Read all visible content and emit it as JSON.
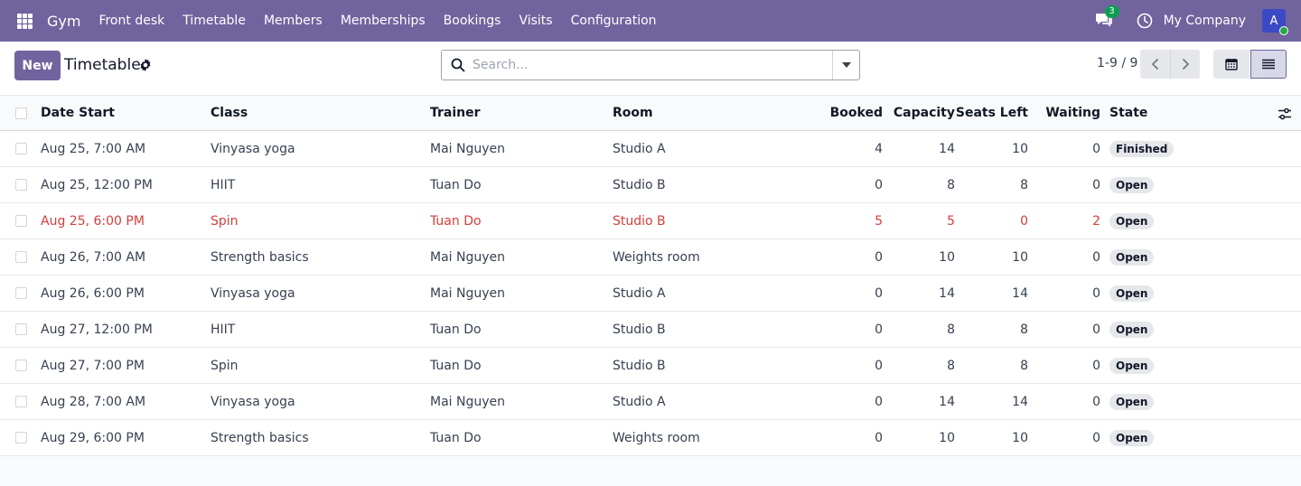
{
  "navbar": {
    "app_name": "Gym",
    "menu": [
      "Front desk",
      "Timetable",
      "Members",
      "Memberships",
      "Bookings",
      "Visits",
      "Configuration"
    ],
    "chat_count": "3",
    "company": "My Company",
    "avatar_letter": "A",
    "color": "#71639e"
  },
  "control": {
    "new_label": "New",
    "title": "Timetable",
    "search_placeholder": "Search...",
    "pager": "1-9 / 9"
  },
  "table": {
    "columns": [
      "Date Start",
      "Class",
      "Trainer",
      "Room",
      "Booked",
      "Capacity",
      "Seats Left",
      "Waiting",
      "State"
    ],
    "rows": [
      {
        "date": "Aug 25, 7:00 AM",
        "class": "Vinyasa yoga",
        "trainer": "Mai Nguyen",
        "room": "Studio A",
        "booked": "4",
        "capacity": "14",
        "seats": "10",
        "waiting": "0",
        "state": "Finished"
      },
      {
        "date": "Aug 25, 12:00 PM",
        "class": "HIIT",
        "trainer": "Tuan Do",
        "room": "Studio B",
        "booked": "0",
        "capacity": "8",
        "seats": "8",
        "waiting": "0",
        "state": "Open"
      },
      {
        "date": "Aug 25, 6:00 PM",
        "class": "Spin",
        "trainer": "Tuan Do",
        "room": "Studio B",
        "booked": "5",
        "capacity": "5",
        "seats": "0",
        "waiting": "2",
        "state": "Open"
      },
      {
        "date": "Aug 26, 7:00 AM",
        "class": "Strength basics",
        "trainer": "Mai Nguyen",
        "room": "Weights room",
        "booked": "0",
        "capacity": "10",
        "seats": "10",
        "waiting": "0",
        "state": "Open"
      },
      {
        "date": "Aug 26, 6:00 PM",
        "class": "Vinyasa yoga",
        "trainer": "Mai Nguyen",
        "room": "Studio A",
        "booked": "0",
        "capacity": "14",
        "seats": "14",
        "waiting": "0",
        "state": "Open"
      },
      {
        "date": "Aug 27, 12:00 PM",
        "class": "HIIT",
        "trainer": "Tuan Do",
        "room": "Studio B",
        "booked": "0",
        "capacity": "8",
        "seats": "8",
        "waiting": "0",
        "state": "Open"
      },
      {
        "date": "Aug 27, 7:00 PM",
        "class": "Spin",
        "trainer": "Tuan Do",
        "room": "Studio B",
        "booked": "0",
        "capacity": "8",
        "seats": "8",
        "waiting": "0",
        "state": "Open"
      },
      {
        "date": "Aug 28, 7:00 AM",
        "class": "Vinyasa yoga",
        "trainer": "Mai Nguyen",
        "room": "Studio A",
        "booked": "0",
        "capacity": "14",
        "seats": "14",
        "waiting": "0",
        "state": "Open"
      },
      {
        "date": "Aug 29, 6:00 PM",
        "class": "Strength basics",
        "trainer": "Tuan Do",
        "room": "Weights room",
        "booked": "0",
        "capacity": "10",
        "seats": "10",
        "waiting": "0",
        "state": "Open"
      }
    ]
  }
}
